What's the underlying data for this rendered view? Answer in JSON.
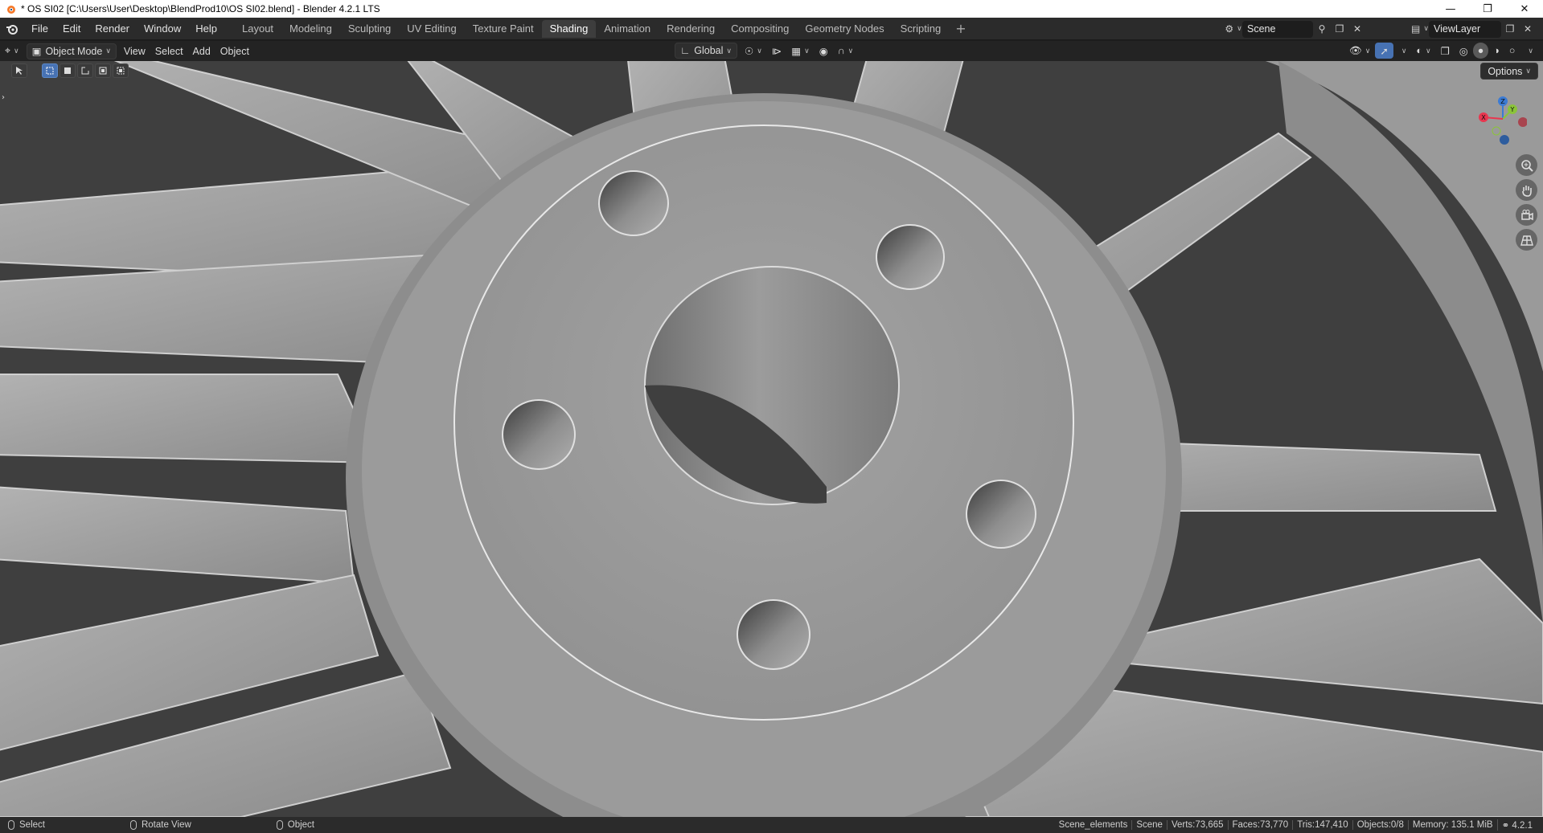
{
  "window": {
    "title": "* OS SI02 [C:\\Users\\User\\Desktop\\BlendProd10\\OS SI02.blend] - Blender 4.2.1 LTS",
    "controls": [
      "minimize-icon",
      "restore-icon",
      "close-icon"
    ]
  },
  "menu": {
    "items": [
      "File",
      "Edit",
      "Render",
      "Window",
      "Help"
    ]
  },
  "workspaces": {
    "tabs": [
      "Layout",
      "Modeling",
      "Sculpting",
      "UV Editing",
      "Texture Paint",
      "Shading",
      "Animation",
      "Rendering",
      "Compositing",
      "Geometry Nodes",
      "Scripting"
    ],
    "active": "Shading",
    "add_label": "+"
  },
  "scene": {
    "name": "Scene",
    "view_layer": "ViewLayer"
  },
  "viewport_header": {
    "mode": "Object Mode",
    "menus": [
      "View",
      "Select",
      "Add",
      "Object"
    ],
    "orientation": "Global"
  },
  "viewport": {
    "options_label": "Options",
    "gizmo_axes": [
      "X",
      "Y",
      "Z"
    ],
    "colors": {
      "x": "#e8364f",
      "y": "#8bc43a",
      "z": "#3b7bd4",
      "background": "#3f3f3f",
      "wheel": "#999999"
    }
  },
  "status": {
    "hints": [
      {
        "label": "Select"
      },
      {
        "label": "Rotate View"
      },
      {
        "label": "Object"
      }
    ],
    "stats": [
      "Scene_elements",
      "Scene",
      "Verts:73,665",
      "Faces:73,770",
      "Tris:147,410",
      "Objects:0/8",
      "Memory: 135.1 MiB",
      "4.2.1"
    ]
  }
}
